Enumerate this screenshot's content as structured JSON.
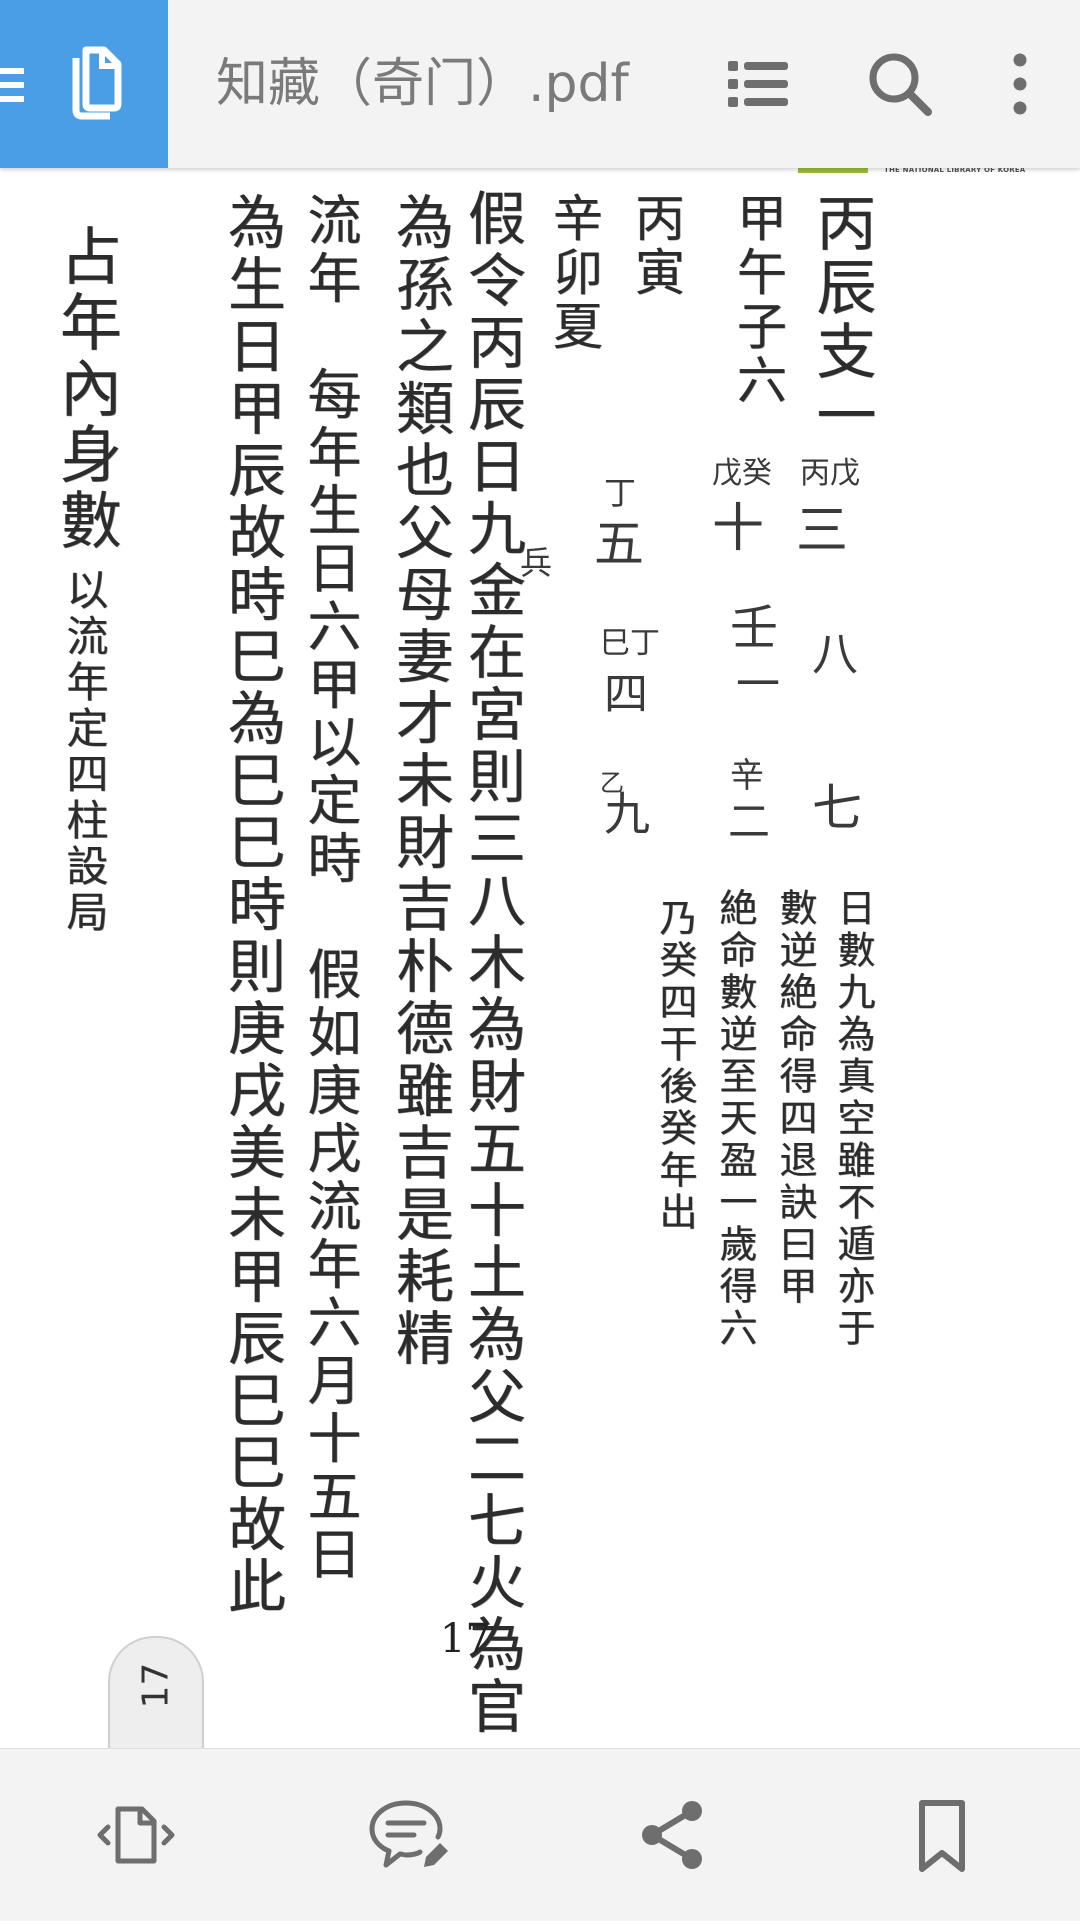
{
  "toolbar": {
    "title": "知藏（奇门）.pdf",
    "icons": [
      "menu-icon",
      "copy-documents-icon",
      "list-icon",
      "search-icon",
      "more-vertical-icon"
    ]
  },
  "page": {
    "library_label": "THE NATIONAL LIBRARY OF KOREA",
    "columns": [
      "丙辰支一",
      "甲午子六",
      "丙寅",
      "辛卯夏",
      "假令丙辰日九金在宮則三八木為財五十土為父二七火為官一六水",
      "為孫之類也父母妻才未財吉朴德雖吉是耗精",
      "流年　每年生日六甲以定時　假如庚戌流年六月十五日",
      "為生日甲辰故時巳為巳巳時則庚戌美未甲辰巳巳故此",
      "占年內身數",
      "以流年定四柱設局",
      "日數九為真空雖不遁亦于",
      "數逆絶命得四退訣曰甲",
      "絶命數逆至天盈一歲得六",
      "乃癸四干後癸年出"
    ],
    "notes": [
      "丙戊",
      "三",
      "戊癸",
      "十",
      "丁",
      "五",
      "壬",
      "一",
      "巳丁",
      "四",
      "八",
      "七",
      "辛",
      "二",
      "九",
      "乙",
      "兵"
    ],
    "page_number": "17"
  },
  "page_tab": {
    "label": "17"
  },
  "bottombar": {
    "icons": [
      "page-transition-icon",
      "comment-edit-icon",
      "share-icon",
      "bookmark-icon"
    ]
  },
  "colors": {
    "accent": "#4a9ee6",
    "toolbar_bg": "#f3f3f3",
    "icon": "#6e6e6e"
  }
}
